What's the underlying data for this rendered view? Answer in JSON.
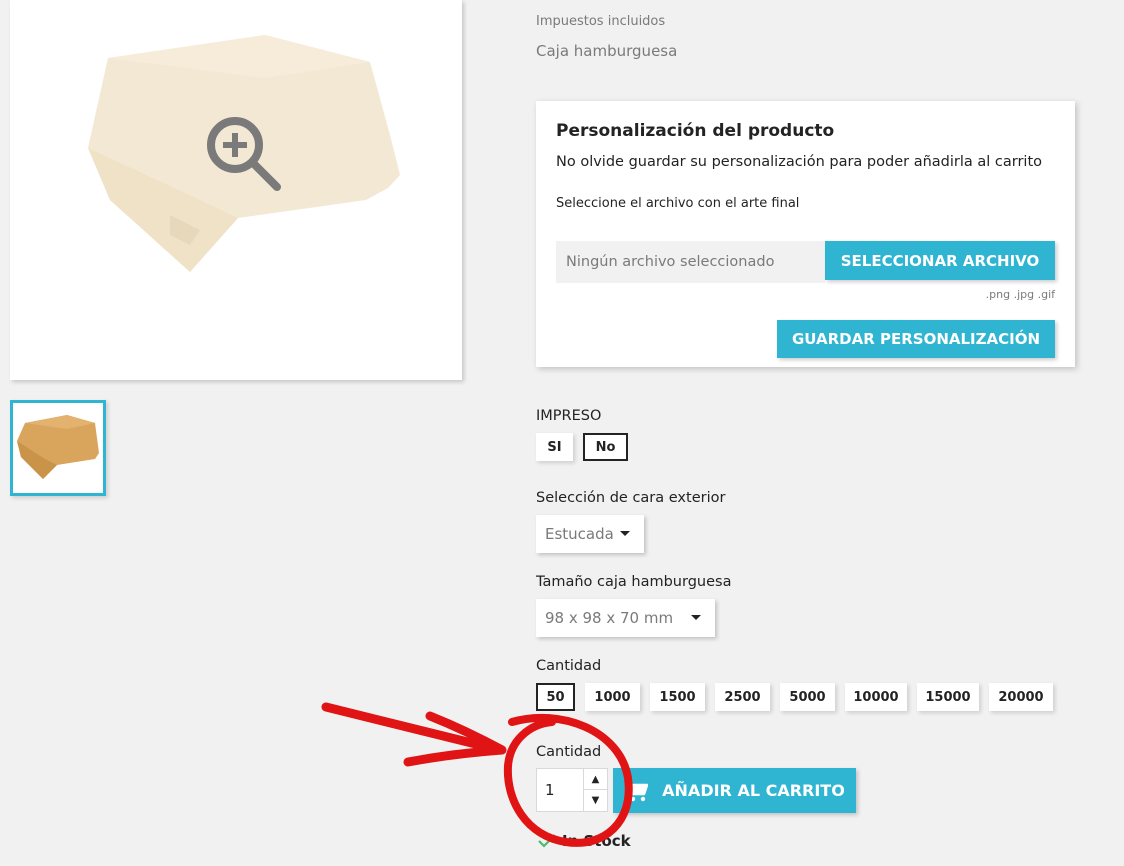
{
  "product": {
    "tax_note": "Impuestos incluidos",
    "short_description": "Caja hamburguesa"
  },
  "customization": {
    "title": "Personalización del producto",
    "note": "No olvide guardar su personalización para poder añadirla al carrito",
    "file_label": "Seleccione el archivo con el arte final",
    "file_placeholder": "Ningún archivo seleccionado",
    "select_file_label": "SELECCIONAR ARCHIVO",
    "file_types": ".png .jpg .gif",
    "save_label": "GUARDAR PERSONALIZACIÓN"
  },
  "printed": {
    "label": "IMPRESO",
    "options": [
      "SI",
      "No"
    ],
    "selected": "No"
  },
  "face": {
    "label": "Selección de cara exterior",
    "selected": "Estucada"
  },
  "size": {
    "label": "Tamaño caja hamburguesa",
    "selected": "98 x 98 x 70 mm"
  },
  "quantity_options": {
    "label": "Cantidad",
    "options": [
      "50",
      "1000",
      "1500",
      "2500",
      "5000",
      "10000",
      "15000",
      "20000"
    ],
    "selected": "50"
  },
  "cart": {
    "qty_label": "Cantidad",
    "qty_value": "1",
    "add_label": "AÑADIR AL CARRITO",
    "stock_label": "In Stock"
  },
  "colors": {
    "accent": "#2fb5d2",
    "annotation": "#e01414",
    "stock_check": "#4cbb6c"
  }
}
